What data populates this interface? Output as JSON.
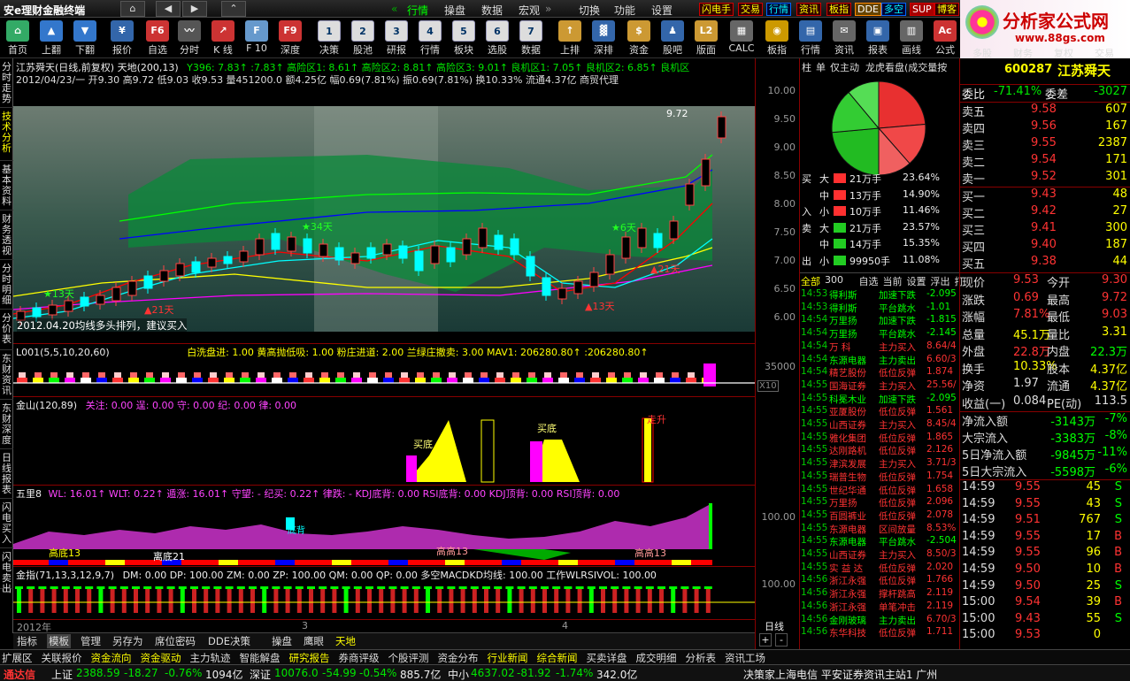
{
  "app": {
    "title": "安e理财金融终端"
  },
  "topnav": {
    "menus": [
      "行情",
      "操盘",
      "数据",
      "宏观",
      "切换",
      "功能",
      "设置"
    ],
    "tags": [
      "闪电手",
      "交易",
      "行情",
      "资讯",
      "板指",
      "DDE",
      "多空",
      "SUP",
      "博客"
    ]
  },
  "logo": {
    "line1": "分析家公式网",
    "line2": "www.88gs.com"
  },
  "toolbar": [
    {
      "icon": "⌂",
      "label": "首页",
      "color": "#3a6"
    },
    {
      "icon": "▲",
      "label": "上翻",
      "color": "#37c"
    },
    {
      "icon": "▼",
      "label": "下翻",
      "color": "#37c"
    },
    {
      "icon": "¥",
      "label": "报价",
      "color": "#36a"
    },
    {
      "icon": "F6",
      "label": "自选",
      "color": "#c33"
    },
    {
      "icon": "〰",
      "label": "分时",
      "color": "#555"
    },
    {
      "icon": "↗",
      "label": "K 线",
      "color": "#c33"
    },
    {
      "icon": "F",
      "label": "F 10",
      "color": "#69c"
    },
    {
      "icon": "F9",
      "label": "深度",
      "color": "#c33"
    },
    {
      "icon": "1",
      "label": "决策",
      "color": "#ddd"
    },
    {
      "icon": "2",
      "label": "股池",
      "color": "#ddd"
    },
    {
      "icon": "3",
      "label": "研报",
      "color": "#ddd"
    },
    {
      "icon": "4",
      "label": "行情",
      "color": "#ddd"
    },
    {
      "icon": "5",
      "label": "板块",
      "color": "#ddd"
    },
    {
      "icon": "6",
      "label": "选股",
      "color": "#ddd"
    },
    {
      "icon": "7",
      "label": "数据",
      "color": "#ddd"
    },
    {
      "icon": "↑",
      "label": "上排",
      "color": "#c93"
    },
    {
      "icon": "▓",
      "label": "深排",
      "color": "#36a"
    },
    {
      "icon": "$",
      "label": "资金",
      "color": "#c93"
    },
    {
      "icon": "♟",
      "label": "股吧",
      "color": "#36a"
    },
    {
      "icon": "L2",
      "label": "版面",
      "color": "#c93"
    },
    {
      "icon": "▦",
      "label": "CALC",
      "color": "#666"
    },
    {
      "icon": "◉",
      "label": "板指",
      "color": "#c90"
    },
    {
      "icon": "▤",
      "label": "行情",
      "color": "#36a"
    },
    {
      "icon": "✉",
      "label": "资讯",
      "color": "#666"
    },
    {
      "icon": "▣",
      "label": "报表",
      "color": "#36a"
    },
    {
      "icon": "▥",
      "label": "画线",
      "color": "#666"
    },
    {
      "icon": "Ac",
      "label": "公式",
      "color": "#c33"
    }
  ],
  "sidetabs": [
    "分时走势",
    "技术分析",
    "基本资料",
    "财务透视",
    "分时明细",
    "分价表",
    "东财资讯",
    "东财深度",
    "日线报表",
    "闪电买入",
    "闪电卖出"
  ],
  "chart": {
    "info1": "江苏舜天(日线,前复权) 天地(200,13)",
    "info1b": "Y396: 7.83↑  :7.83↑  高险区1: 8.61↑  高险区2: 8.81↑  高险区3: 9.01↑  良机区1: 7.05↑  良机区2: 6.85↑  良机区",
    "info2": "2012/04/23/一 开9.30 高9.72 低9.03 收9.53 量451200.0 额4.25亿 幅0.69(7.81%) 振0.69(7.81%) 换10.33% 流通4.37亿 商贸代理",
    "note": "2012.04.20均线多头排列，建议买入",
    "max_label": "9.72",
    "yticks": [
      "10.00",
      "9.50",
      "9.00",
      "8.50",
      "8.00",
      "7.50",
      "7.00",
      "6.50",
      "6.00"
    ],
    "markers": [
      "13天",
      "21天",
      "34天",
      "6天",
      "21天",
      "13天"
    ]
  },
  "ind1": {
    "header": "L001(5,5,10,20,60)",
    "legend": "白洗盘进: 1.00  黄高抛低吸: 1.00  粉庄进道: 2.00  兰绿庄撤卖: 3.00  MAV1: 206280.80↑  :206280.80↑",
    "ytick": "35000",
    "x10": "X10"
  },
  "ind2": {
    "header": "金山(120,89)",
    "legend": "关注: 0.00   逞: 0.00  守: 0.00  纪: 0.00  律: 0.00",
    "labels": [
      "买底",
      "买底",
      "走升"
    ]
  },
  "ind3": {
    "header": "五里8",
    "legend": "WL: 16.01↑  WLT: 0.22↑  遁涨: 16.01↑  守望: -  纪买: 0.22↑  律跌: -  KDJ底背: 0.00  RSI底背: 0.00  KDJ顶背: 0.00  RSI顶背: 0.00",
    "labels": [
      "底背",
      "高底13",
      "抄底",
      "离底21",
      "低背",
      "买",
      "高高13",
      "抄底"
    ],
    "ytick": "100.00"
  },
  "ind4": {
    "header": "金指(71,13,3,12,9,7)",
    "legend": "DM: 0.00  DP: 100.00  ZM: 0.00  ZP: 100.00  QM: 0.00  QP: 0.00  多空MACDKD均线: 100.00  工作WLRSIVOL: 100.00",
    "ytick": "100.00"
  },
  "xaxis": {
    "labels": [
      "2012年",
      "3",
      "4"
    ],
    "daily": "日线"
  },
  "bottomtabs": [
    "指标",
    "模板",
    "管理",
    "另存为",
    "席位密码",
    "DDE决策",
    "操盘",
    "鹰眼",
    "天地"
  ],
  "bottomtabs2": [
    "扩展区",
    "关联报价",
    "资金流向",
    "资金驱动",
    "主力轨迹",
    "智能解盘",
    "研究报告",
    "券商评级",
    "个股评测",
    "资金分布",
    "行业新闻",
    "综合新闻",
    "买卖详盘",
    "成交明细",
    "分析表",
    "资讯工场"
  ],
  "rp1": {
    "tabs": [
      "柱",
      "单",
      "仅主动",
      "龙虎看盘(成交量按"
    ],
    "pie": [
      {
        "side": "买",
        "size": "大",
        "label": "21万手",
        "pct": "23.64%",
        "color": "#ff3030"
      },
      {
        "side": "",
        "size": "中",
        "label": "13万手",
        "pct": "14.90%",
        "color": "#ff3030"
      },
      {
        "side": "入",
        "size": "小",
        "label": "10万手",
        "pct": "11.46%",
        "color": "#ff3030"
      },
      {
        "side": "卖",
        "size": "大",
        "label": "21万手",
        "pct": "23.57%",
        "color": "#22cc22"
      },
      {
        "side": "",
        "size": "中",
        "label": "14万手",
        "pct": "15.35%",
        "color": "#22cc22"
      },
      {
        "side": "出",
        "size": "小",
        "label": "99950手",
        "pct": "11.08%",
        "color": "#22cc22"
      }
    ],
    "filters": [
      "全部",
      "300",
      "自选",
      "当前",
      "设置",
      "浮出",
      "打"
    ],
    "ticker": [
      [
        "14:53",
        "得利斯",
        "加速下跌",
        "-2.095"
      ],
      [
        "14:53",
        "得利斯",
        "平台跳水",
        "-1.01"
      ],
      [
        "14:54",
        "万里扬",
        "加速下跌",
        "-1.815"
      ],
      [
        "14:54",
        "万里扬",
        "平台跳水",
        "-2.145"
      ],
      [
        "14:54",
        "万 科",
        "主力买入",
        "8.64/4"
      ],
      [
        "14:54",
        "东源电器",
        "主力卖出",
        "6.60/3"
      ],
      [
        "14:54",
        "精艺股份",
        "低位反弹",
        "1.874"
      ],
      [
        "14:55",
        "国海证券",
        "主力买入",
        "25.56/"
      ],
      [
        "14:55",
        "科冕木业",
        "加速下跌",
        "-2.095"
      ],
      [
        "14:55",
        "亚厦股份",
        "低位反弹",
        "1.561"
      ],
      [
        "14:55",
        "山西证券",
        "主力买入",
        "8.45/4"
      ],
      [
        "14:55",
        "雅化集团",
        "低位反弹",
        "1.865"
      ],
      [
        "14:55",
        "达刚路机",
        "低位反弹",
        "2.126"
      ],
      [
        "14:55",
        "津滨发展",
        "主力买入",
        "3.71/3"
      ],
      [
        "14:55",
        "瑞普生物",
        "低位反弹",
        "1.754"
      ],
      [
        "14:55",
        "世纪华通",
        "低位反弹",
        "1.658"
      ],
      [
        "14:55",
        "万里扬",
        "低位反弹",
        "2.096"
      ],
      [
        "14:55",
        "百圆裤业",
        "低位反弹",
        "2.078"
      ],
      [
        "14:55",
        "东源电器",
        "区间放量",
        "8.53%"
      ],
      [
        "14:55",
        "东源电器",
        "平台跳水",
        "-2.504"
      ],
      [
        "14:55",
        "山西证券",
        "主力买入",
        "8.50/3"
      ],
      [
        "14:55",
        "实 益 达",
        "低位反弹",
        "2.020"
      ],
      [
        "14:56",
        "浙江永强",
        "低位反弹",
        "1.766"
      ],
      [
        "14:56",
        "浙江永强",
        "撑杆跳高",
        "2.119"
      ],
      [
        "14:56",
        "浙江永强",
        "单笔冲击",
        "2.119"
      ],
      [
        "14:56",
        "金刚玻璃",
        "主力卖出",
        "6.70/3"
      ],
      [
        "14:56",
        "东华科技",
        "低位反弹",
        "1.711"
      ]
    ]
  },
  "rp2": {
    "code": "600287",
    "name": "江苏舜天",
    "weibi": "-71.41%",
    "weicha": "-3027",
    "asks": [
      [
        "卖五",
        "9.58",
        "607"
      ],
      [
        "卖四",
        "9.56",
        "167"
      ],
      [
        "卖三",
        "9.55",
        "2387"
      ],
      [
        "卖二",
        "9.54",
        "171"
      ],
      [
        "卖一",
        "9.52",
        "301"
      ]
    ],
    "bids": [
      [
        "买一",
        "9.43",
        "48"
      ],
      [
        "买二",
        "9.42",
        "27"
      ],
      [
        "买三",
        "9.41",
        "300"
      ],
      [
        "买四",
        "9.40",
        "187"
      ],
      [
        "买五",
        "9.38",
        "44"
      ]
    ],
    "stats": [
      [
        "现价",
        "9.53",
        "今开",
        "9.30"
      ],
      [
        "涨跌",
        "0.69",
        "最高",
        "9.72"
      ],
      [
        "涨幅",
        "7.81%",
        "最低",
        "9.03"
      ],
      [
        "总量",
        "45.1万",
        "量比",
        "3.31"
      ],
      [
        "外盘",
        "22.8万",
        "内盘",
        "22.3万"
      ],
      [
        "换手",
        "10.33%",
        "股本",
        "4.37亿"
      ],
      [
        "净资",
        "1.97",
        "流通",
        "4.37亿"
      ],
      [
        "收益(一)",
        "0.084",
        "PE(动)",
        "113.5"
      ]
    ],
    "flows": [
      [
        "净流入额",
        "-3143万",
        "-7%"
      ],
      [
        "大宗流入",
        "-3383万",
        "-8%"
      ],
      [
        "5日净流入额",
        "-9845万",
        "-11%"
      ],
      [
        "5日大宗流入",
        "-5598万",
        "-6%"
      ]
    ],
    "trades": [
      [
        "14:59",
        "9.55",
        "45",
        "S"
      ],
      [
        "14:59",
        "9.55",
        "43",
        "S"
      ],
      [
        "14:59",
        "9.51",
        "767",
        "S"
      ],
      [
        "14:59",
        "9.55",
        "17",
        "B"
      ],
      [
        "14:59",
        "9.55",
        "96",
        "B"
      ],
      [
        "14:59",
        "9.50",
        "10",
        "B"
      ],
      [
        "14:59",
        "9.50",
        "25",
        "S"
      ],
      [
        "15:00",
        "9.54",
        "39",
        "B"
      ],
      [
        "15:00",
        "9.43",
        "55",
        "S"
      ],
      [
        "15:00",
        "9.53",
        "0",
        ""
      ]
    ],
    "tabs": [
      "主力",
      "关联",
      "分价",
      "筹码"
    ],
    "toptabs": [
      "多股",
      "财务",
      "复权",
      "交易"
    ]
  },
  "status": {
    "brand": "通达信",
    "sh": "上证",
    "sh_v": "2388.59",
    "sh_c": "-18.27",
    "sh_p": "-0.76%",
    "sh_a": "1094亿",
    "sz": "深证",
    "sz_v": "10076.0",
    "sz_c": "-54.99",
    "sz_p": "-0.54%",
    "sz_a": "885.7亿",
    "zx": "中小",
    "zx_v": "4637.02",
    "zx_c": "-81.92",
    "zx_p": "-1.74%",
    "zx_a": "342.0亿",
    "news": "决策家上海电信  平安证券资讯主站1  广州"
  }
}
